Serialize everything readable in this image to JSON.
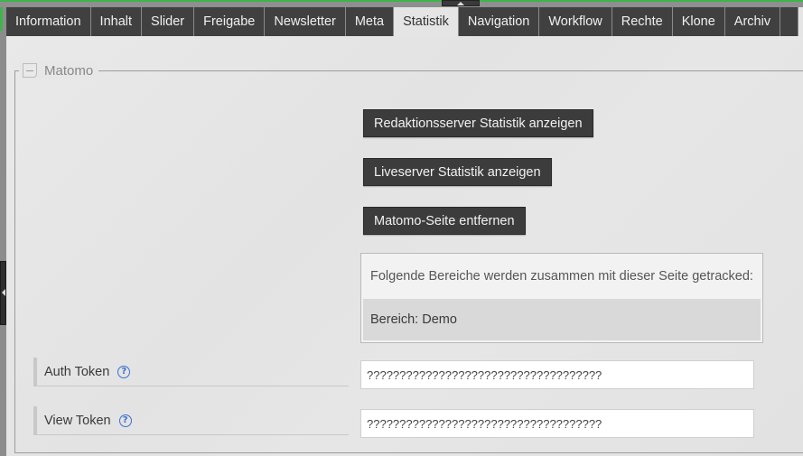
{
  "tabs": [
    {
      "label": "Information",
      "active": false
    },
    {
      "label": "Inhalt",
      "active": false
    },
    {
      "label": "Slider",
      "active": false
    },
    {
      "label": "Freigabe",
      "active": false
    },
    {
      "label": "Newsletter",
      "active": false
    },
    {
      "label": "Meta",
      "active": false
    },
    {
      "label": "Statistik",
      "active": true
    },
    {
      "label": "Navigation",
      "active": false
    },
    {
      "label": "Workflow",
      "active": false
    },
    {
      "label": "Rechte",
      "active": false
    },
    {
      "label": "Klone",
      "active": false
    },
    {
      "label": "Archiv",
      "active": false
    }
  ],
  "section": {
    "legend": "Matomo",
    "toggle_icon": "collapse-minus"
  },
  "buttons": {
    "editorial_stats": "Redaktionsserver Statistik anzeigen",
    "live_stats": "Liveserver Statistik anzeigen",
    "remove_site": "Matomo-Seite entfernen"
  },
  "tracking_info": {
    "heading": "Folgende Bereiche werden zusammen mit dieser Seite getracked:",
    "areas": [
      "Bereich: Demo"
    ]
  },
  "fields": {
    "auth_token": {
      "label": "Auth Token",
      "value": "????????????????????????????????????",
      "help_icon": "question-circle"
    },
    "view_token": {
      "label": "View Token",
      "value": "????????????????????????????????????",
      "help_icon": "question-circle"
    }
  },
  "colors": {
    "accent_green": "#3db54a",
    "tab_bg": "#404040",
    "help_blue": "#3a6fd0"
  }
}
